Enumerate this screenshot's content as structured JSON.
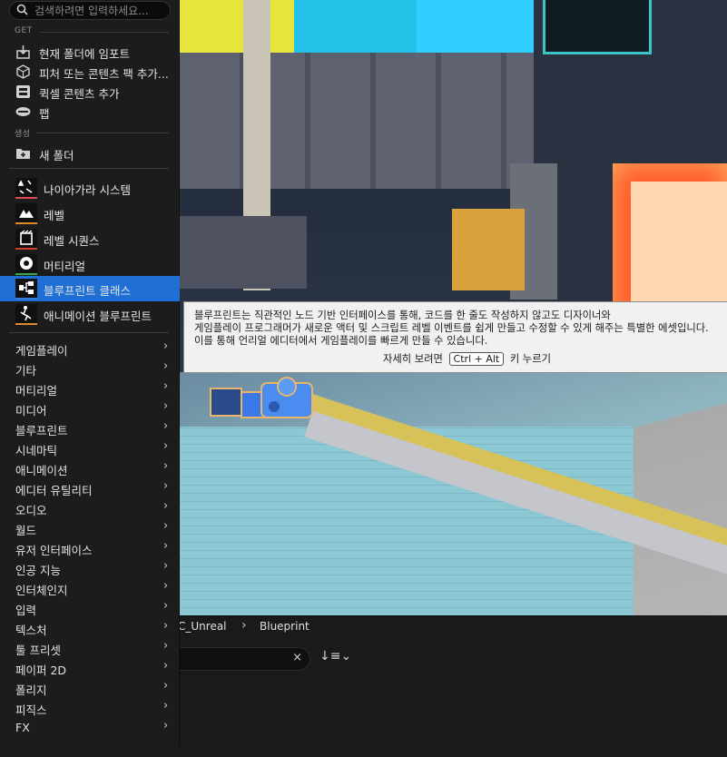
{
  "menu": {
    "search_placeholder": "검색하려면 입력하세요...",
    "section_get": "GET",
    "get_items": [
      {
        "label": "현재 폴더에 임포트",
        "icon": "import-icon"
      },
      {
        "label": "피처 또는 콘텐츠 팩 추가...",
        "icon": "feature-pack-icon"
      },
      {
        "label": "퀵셀 콘텐츠 추가",
        "icon": "quixel-icon"
      },
      {
        "label": "팹",
        "icon": "fab-icon"
      }
    ],
    "section_create": "생성",
    "new_folder": {
      "label": "새 폴더",
      "icon": "new-folder-icon"
    },
    "assets": [
      {
        "label": "나이아가라 시스템",
        "icon": "niagara-icon",
        "accent": "#e04a4a"
      },
      {
        "label": "레벨",
        "icon": "level-icon",
        "accent": "#e08a2a"
      },
      {
        "label": "레벨 시퀀스",
        "icon": "level-sequence-icon",
        "accent": "#d0402a"
      },
      {
        "label": "머티리얼",
        "icon": "material-icon",
        "accent": "#3aa84a"
      },
      {
        "label": "블루프린트 클래스",
        "icon": "blueprint-class-icon",
        "accent": "#3a7ad8"
      },
      {
        "label": "애니메이션 블루프린트",
        "icon": "anim-blueprint-icon",
        "accent": "#e08a2a"
      }
    ],
    "selected_color": "#1f6fd4",
    "categories": [
      "게임플레이",
      "기타",
      "머티리얼",
      "미디어",
      "블루프린트",
      "시네마틱",
      "애니메이션",
      "에디터 유틸리티",
      "오디오",
      "월드",
      "유저 인터페이스",
      "인공 지능",
      "인터체인지",
      "입력",
      "텍스처",
      "툴 프리셋",
      "페이퍼 2D",
      "폴리지",
      "피직스",
      "FX"
    ]
  },
  "tooltip": {
    "lines": [
      "블루프린트는 직관적인 노드 기반 인터페이스를 통해, 코드를 한 줄도 작성하지 않고도 디자이너와",
      "게임플레이 프로그래머가 새로운 액터 및 스크립트 레벨 이벤트를 쉽게 만들고 수정할 수 있게 해주는 특별한 에셋입니다.",
      "이를 통해 언리얼 에디터에서 게임플레이를 빠르게 만들 수 있습니다."
    ],
    "more_prefix": "자세히 보려면",
    "shortcut": "Ctrl + Alt",
    "more_suffix": "키 누르기"
  },
  "browser": {
    "breadcrumb": [
      "C_Unreal",
      "Blueprint"
    ],
    "clear_symbol": "×",
    "sort_symbol": "↓≡⌄"
  }
}
